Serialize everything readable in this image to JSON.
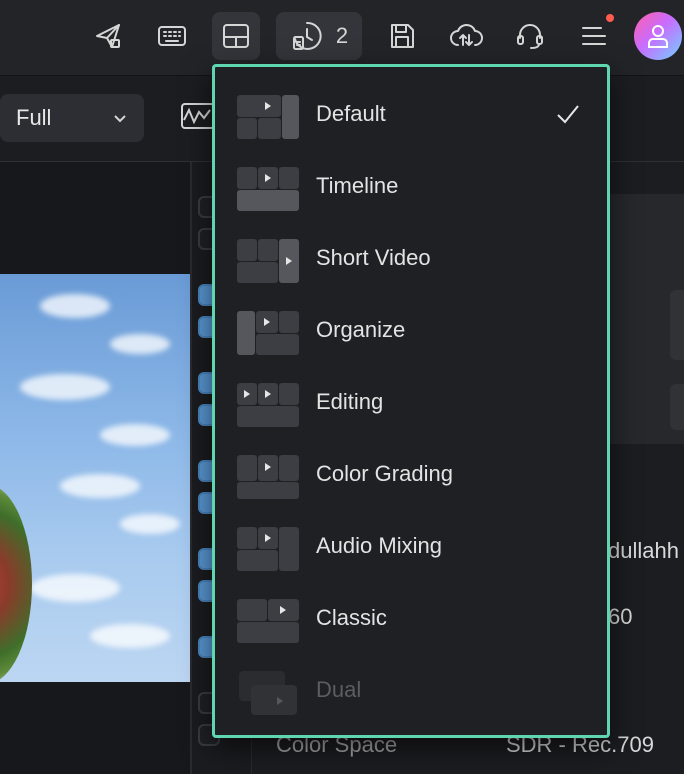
{
  "toolbar": {
    "items": [
      {
        "name": "send-icon"
      },
      {
        "name": "keyboard-icon"
      },
      {
        "name": "layout-icon"
      },
      {
        "name": "history-icon",
        "count": "2"
      },
      {
        "name": "save-icon"
      },
      {
        "name": "cloud-upload-icon"
      },
      {
        "name": "headset-icon"
      },
      {
        "name": "menu-icon"
      }
    ],
    "notification_color": "#ff5b4f"
  },
  "subbar": {
    "zoom_value": "Full"
  },
  "layout_menu": {
    "accent_color": "#5fd5b0",
    "selected": "Default",
    "items": [
      {
        "label": "Default",
        "checked": true,
        "disabled": false
      },
      {
        "label": "Timeline",
        "checked": false,
        "disabled": false
      },
      {
        "label": "Short Video",
        "checked": false,
        "disabled": false
      },
      {
        "label": "Organize",
        "checked": false,
        "disabled": false
      },
      {
        "label": "Editing",
        "checked": false,
        "disabled": false
      },
      {
        "label": "Color Grading",
        "checked": false,
        "disabled": false
      },
      {
        "label": "Audio Mixing",
        "checked": false,
        "disabled": false
      },
      {
        "label": "Classic",
        "checked": false,
        "disabled": false
      },
      {
        "label": "Dual",
        "checked": false,
        "disabled": true
      }
    ]
  },
  "inspector": {
    "partial_author": "dullahh",
    "partial_number": "60",
    "color_space_label": "Color Space",
    "color_space_value": "SDR - Rec.709"
  }
}
